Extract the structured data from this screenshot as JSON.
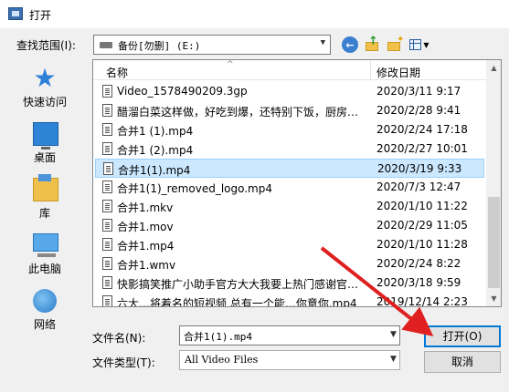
{
  "window": {
    "title": "打开",
    "icon": "open-dialog-icon"
  },
  "toolbar": {
    "look_in_label": "查找范围(I):",
    "look_in_value": "备份[勿删] (E:)",
    "icons": [
      "back-arrow-icon",
      "up-folder-icon",
      "new-folder-icon",
      "view-menu-icon"
    ]
  },
  "places": [
    {
      "label": "快速访问",
      "icon": "star-icon"
    },
    {
      "label": "桌面",
      "icon": "desktop-icon"
    },
    {
      "label": "库",
      "icon": "library-icon"
    },
    {
      "label": "此电脑",
      "icon": "computer-icon"
    },
    {
      "label": "网络",
      "icon": "network-icon"
    }
  ],
  "file_list": {
    "columns": {
      "name": "名称",
      "date": "修改日期"
    },
    "rows": [
      {
        "name": "Video_1578490209.3gp",
        "date": "2020/3/11 9:17"
      },
      {
        "name": "醋溜白菜这样做，好吃到爆，还特别下饭，厨房小...",
        "date": "2020/2/28 9:41"
      },
      {
        "name": "合并1 (1).mp4",
        "date": "2020/2/24 17:18"
      },
      {
        "name": "合并1 (2).mp4",
        "date": "2020/2/27 10:01"
      },
      {
        "name": "合并1(1).mp4",
        "date": "2020/3/19 9:33"
      },
      {
        "name": "合并1(1)_removed_logo.mp4",
        "date": "2020/7/3 12:47"
      },
      {
        "name": "合并1.mkv",
        "date": "2020/1/10 11:22"
      },
      {
        "name": "合并1.mov",
        "date": "2020/2/29 11:05"
      },
      {
        "name": "合并1.mp4",
        "date": "2020/1/10 11:28"
      },
      {
        "name": "合并1.wmv",
        "date": "2020/2/24 8:22"
      },
      {
        "name": "快影搞笑推广小助手官方大大我要上热门感谢官方...",
        "date": "2020/3/18 9:59"
      },
      {
        "name": "六大…将着名的短视频 总有一个能…你意你.mp4",
        "date": "2019/12/14 2:23"
      }
    ],
    "selected_index": 4
  },
  "form": {
    "filename_label": "文件名(N):",
    "filename_value": "合并1(1).mp4",
    "filetype_label": "文件类型(T):",
    "filetype_value": "All Video Files"
  },
  "buttons": {
    "open": "打开(O)",
    "cancel": "取消"
  },
  "colors": {
    "accent": "#0078d7",
    "selection": "#cce8ff",
    "arrow": "#e02020"
  }
}
